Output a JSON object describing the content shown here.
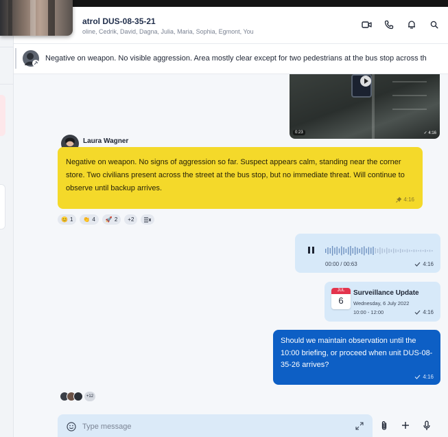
{
  "header": {
    "title": "atrol DUS-08-35-21",
    "members": "oline, Cedrik, David, Dagna, Julia, Maria, Sophia, Egmont, You",
    "actions": [
      "video-call-icon",
      "phone-icon",
      "bell-icon",
      "search-icon"
    ]
  },
  "pinned": {
    "text": "Negative on weapon. No visible aggression. Area mostly clear except for two pedestrians at the bus stop across th"
  },
  "video_message": {
    "duration": "0:23",
    "time": "✓ 4:16"
  },
  "yellow_message": {
    "sender": "Laura Wagner",
    "text": "Negative on weapon. No signs of aggression so far. Suspect appears calm, standing near the corner store. Two civilians present across the street at the bus stop, but no immediate threat. Will continue to observe until backup arrives.",
    "time": "4:16",
    "highlight_color": "#f4d92a"
  },
  "reactions": [
    {
      "emoji": "😊",
      "count": "1"
    },
    {
      "emoji": "👏",
      "count": "4"
    },
    {
      "emoji": "🚀",
      "count": "2"
    },
    {
      "emoji": "",
      "count": "+2"
    }
  ],
  "voice_message": {
    "progress": "00:00 / 00:63",
    "time": "4:16"
  },
  "event_message": {
    "month": "JUL",
    "day": "6",
    "title": "Surveillance Update",
    "date": "Wednesday, 6 July 2022",
    "time_range": "10:00 - 12:00",
    "time": "4:16"
  },
  "outgoing_message": {
    "text": "Should we maintain observation until the 10:00 briefing, or proceed when unit DUS-08-35-26 arrives?",
    "time": "4:16",
    "bubble_color": "#0d5fc5"
  },
  "read_receipts": {
    "more": "+12"
  },
  "composer": {
    "placeholder": "Type message"
  }
}
